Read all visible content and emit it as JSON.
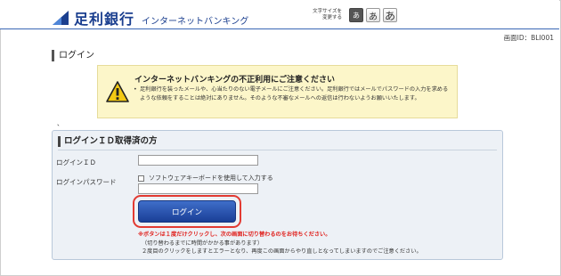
{
  "header": {
    "bank_name": "足利銀行",
    "service_name": "インターネットバンキング",
    "text_size_label": "文字サイズを変更する",
    "text_size_buttons": [
      "あ",
      "あ",
      "あ"
    ]
  },
  "screen_id": "画面ID：BLI001",
  "page_title": "ログイン",
  "warning": {
    "title": "インターネットバンキングの不正利用にご注意ください",
    "body": "足利銀行を装ったメールや、心当たりのない電子メールにご注意ください。足利銀行ではメールでパスワードの入力を求めるような依頼をすることは絶対にありません。そのような不審なメールへの返信は行わないようお願いいたします。"
  },
  "stray_mark": "、",
  "login": {
    "section_title": "ログインＩＤ取得済の方",
    "id_label": "ログインＩＤ",
    "id_value": "",
    "password_label": "ログインパスワード",
    "software_keyboard_label": "ソフトウェアキーボードを使用して入力する",
    "password_value": "",
    "button_label": "ログイン",
    "note_red": "※ボタンは１度だけクリックし、次の画面に切り替わるのをお待ちください。",
    "note_1": "（切り替わるまでに時間がかかる事があります）",
    "note_2": "２度目のクリックをしますとエラーとなり、再度この画面からやり直しとなってしまいますのでご注意ください。"
  },
  "colors": {
    "brand_blue": "#1b3f8f",
    "button_blue": "#1a3f97",
    "highlight_red": "#e23a32",
    "warning_bg": "#fcf6c9",
    "panel_bg": "#edf1f6"
  }
}
